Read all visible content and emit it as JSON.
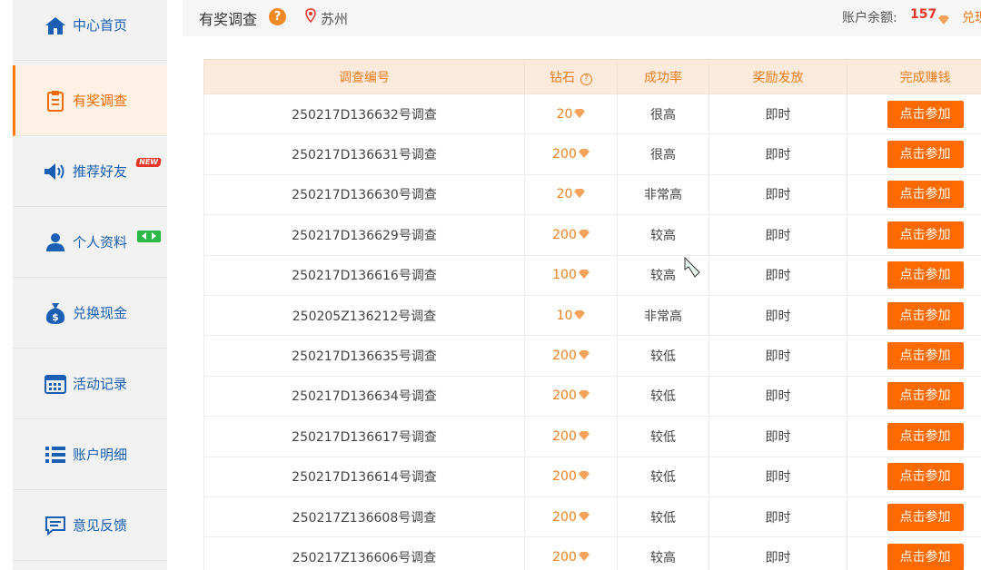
{
  "sidebar": {
    "items": [
      {
        "label": "中心首页",
        "icon": "home-icon"
      },
      {
        "label": "有奖调查",
        "icon": "clipboard-icon",
        "active": true
      },
      {
        "label": "推荐好友",
        "icon": "speaker-icon",
        "badge": "NEW"
      },
      {
        "label": "个人资料",
        "icon": "user-icon"
      },
      {
        "label": "兑换现金",
        "icon": "money-bag-icon"
      },
      {
        "label": "活动记录",
        "icon": "calendar-icon"
      },
      {
        "label": "账户明细",
        "icon": "list-icon"
      },
      {
        "label": "意见反馈",
        "icon": "feedback-icon"
      }
    ]
  },
  "header": {
    "title": "有奖调查",
    "help": "?",
    "city": "苏州",
    "balance_label": "账户余额:",
    "balance_value": "157",
    "exchange_label": "兑现"
  },
  "table": {
    "headers": [
      "调查编号",
      "钻石",
      "成功率",
      "奖励发放",
      "完成赚钱"
    ],
    "rows": [
      {
        "id": "250217D136632号调查",
        "diamonds": "20",
        "rate": "很高",
        "reward": "即时",
        "action": "点击参加"
      },
      {
        "id": "250217D136631号调查",
        "diamonds": "200",
        "rate": "很高",
        "reward": "即时",
        "action": "点击参加"
      },
      {
        "id": "250217D136630号调查",
        "diamonds": "20",
        "rate": "非常高",
        "reward": "即时",
        "action": "点击参加"
      },
      {
        "id": "250217D136629号调查",
        "diamonds": "200",
        "rate": "较高",
        "reward": "即时",
        "action": "点击参加"
      },
      {
        "id": "250217D136616号调查",
        "diamonds": "100",
        "rate": "较高",
        "reward": "即时",
        "action": "点击参加"
      },
      {
        "id": "250205Z136212号调查",
        "diamonds": "10",
        "rate": "非常高",
        "reward": "即时",
        "action": "点击参加"
      },
      {
        "id": "250217D136635号调查",
        "diamonds": "200",
        "rate": "较低",
        "reward": "即时",
        "action": "点击参加"
      },
      {
        "id": "250217D136634号调查",
        "diamonds": "200",
        "rate": "较低",
        "reward": "即时",
        "action": "点击参加"
      },
      {
        "id": "250217D136617号调查",
        "diamonds": "200",
        "rate": "较低",
        "reward": "即时",
        "action": "点击参加"
      },
      {
        "id": "250217D136614号调查",
        "diamonds": "200",
        "rate": "较低",
        "reward": "即时",
        "action": "点击参加"
      },
      {
        "id": "250217Z136608号调查",
        "diamonds": "200",
        "rate": "较低",
        "reward": "即时",
        "action": "点击参加"
      },
      {
        "id": "250217Z136606号调查",
        "diamonds": "200",
        "rate": "较高",
        "reward": "即时",
        "action": "点击参加"
      }
    ]
  },
  "colors": {
    "accent": "#ff6a00",
    "header_bg": "#fcebdc",
    "link_blue": "#1a5fb4",
    "diamond": "#f0811c",
    "balance_red": "#e8372a"
  }
}
